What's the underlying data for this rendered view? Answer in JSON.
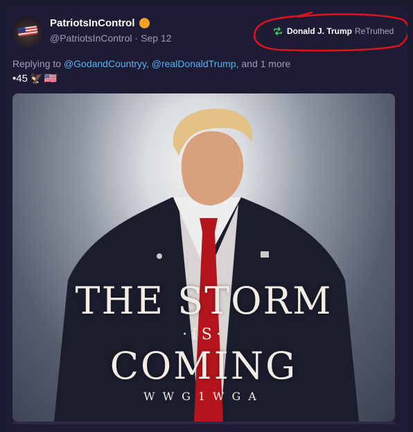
{
  "post": {
    "display_name": "PatriotsInControl",
    "handle": "@PatriotsInControl",
    "separator": "·",
    "date": "Sep 12",
    "retruth": {
      "name": "Donald J. Trump",
      "label": "ReTruthed"
    },
    "replying": {
      "prefix": "Replying to ",
      "mention_1": "@GodandCountryy",
      "comma": ", ",
      "mention_2": "@realDonaldTrump",
      "suffix": ", and 1 more"
    },
    "text": "•45",
    "emoji_eagle": "🦅",
    "emoji_flag": "🇺🇸"
  },
  "media": {
    "line_1": "THE STORM",
    "line_2": "·IS·",
    "line_3": "COMING",
    "line_4": "WWG1WGA"
  },
  "colors": {
    "background": "#1e1b34",
    "mention": "#57b3f3",
    "retruth_icon": "#3bd16f",
    "annotation": "#e0121b",
    "badge": "#f4a31f"
  },
  "icons": {
    "retruth": "retruth-icon",
    "verified_badge": "orange-badge-icon"
  }
}
